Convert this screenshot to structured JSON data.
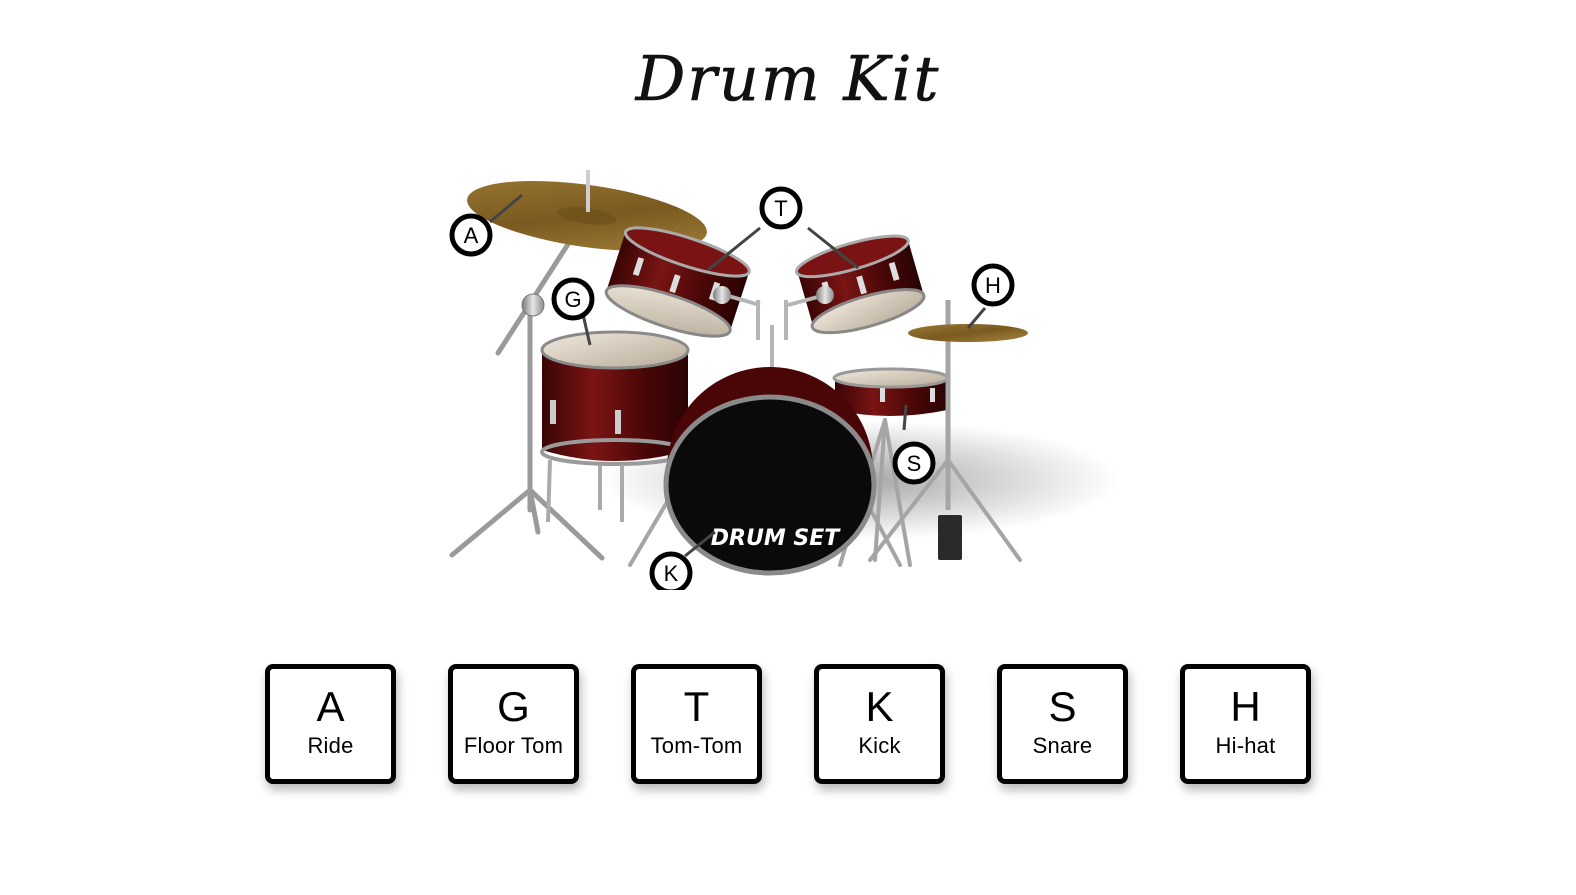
{
  "page": {
    "title": "Drum Kit"
  },
  "kit": {
    "badges": {
      "ride": "A",
      "floor_tom": "G",
      "tom_tom": "T",
      "hi_hat": "H",
      "snare": "S",
      "kick": "K"
    },
    "logo_text": "DRUM SET",
    "colors": {
      "shell": "#5a0a0a",
      "cymbal": "#8a6a2a",
      "head": "#d8cfc0",
      "chrome": "#b8b8b8"
    }
  },
  "keys": [
    {
      "letter": "A",
      "sound": "Ride"
    },
    {
      "letter": "G",
      "sound": "Floor Tom"
    },
    {
      "letter": "T",
      "sound": "Tom-Tom"
    },
    {
      "letter": "K",
      "sound": "Kick"
    },
    {
      "letter": "S",
      "sound": "Snare"
    },
    {
      "letter": "H",
      "sound": "Hi-hat"
    }
  ]
}
